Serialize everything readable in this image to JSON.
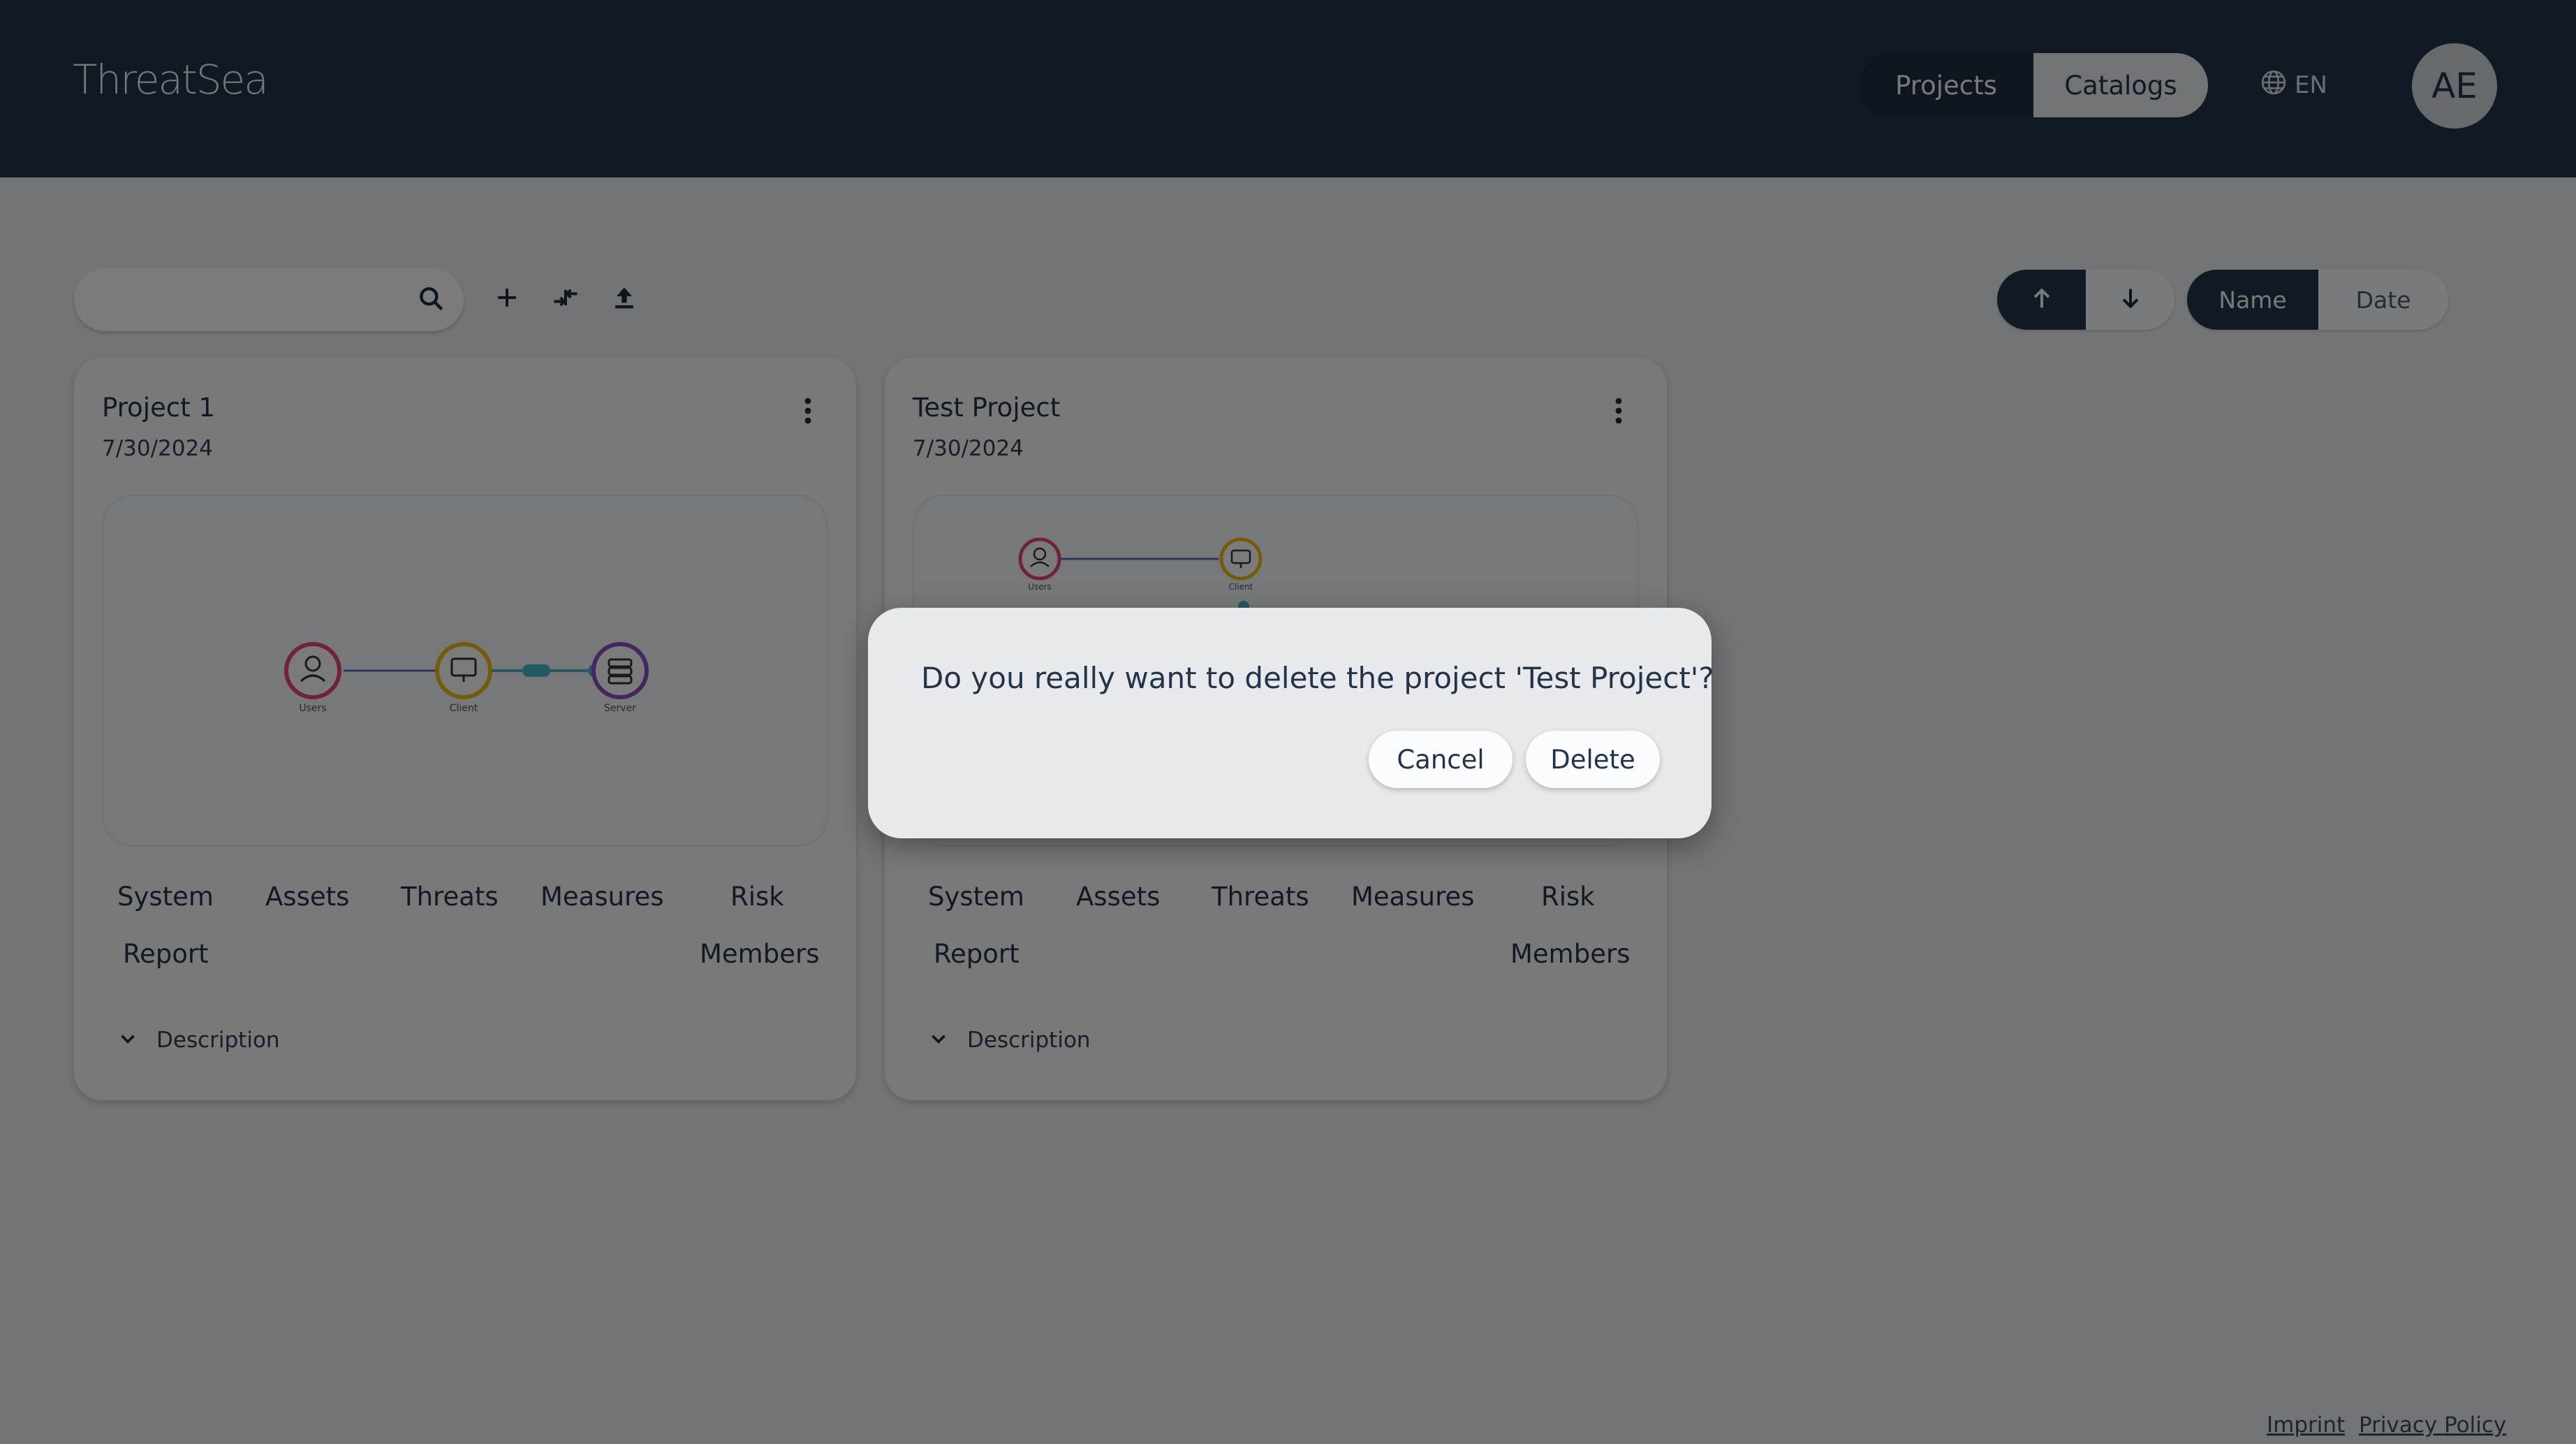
{
  "app": {
    "logo_text": "ThreatSea"
  },
  "header": {
    "nav": {
      "projects_label": "Projects",
      "catalogs_label": "Catalogs"
    },
    "language": {
      "label": "EN",
      "icon": "globe-icon"
    },
    "avatar": {
      "initials": "AE"
    }
  },
  "toolbar": {
    "search": {
      "placeholder": "",
      "icon": "search-icon"
    },
    "add_icon": "plus-icon",
    "import_icon": "import-arrows-icon",
    "upload_icon": "upload-icon",
    "sort_direction": {
      "asc_icon": "arrow-up-icon",
      "desc_icon": "arrow-down-icon",
      "selected": "asc"
    },
    "order_by": {
      "name_label": "Name",
      "date_label": "Date",
      "selected": "Name"
    }
  },
  "projects": [
    {
      "title": "Project 1",
      "date": "7/30/2024",
      "diagram": {
        "nodes": [
          "Users",
          "Client",
          "Server"
        ]
      },
      "links": {
        "system": "System",
        "assets": "Assets",
        "threats": "Threats",
        "measures": "Measures",
        "risk": "Risk",
        "report": "Report",
        "members": "Members"
      },
      "description_label": "Description"
    },
    {
      "title": "Test Project",
      "date": "7/30/2024",
      "diagram": {
        "nodes": [
          "Users",
          "Client"
        ]
      },
      "links": {
        "system": "System",
        "assets": "Assets",
        "threats": "Threats",
        "measures": "Measures",
        "risk": "Risk",
        "report": "Report",
        "members": "Members"
      },
      "description_label": "Description"
    }
  ],
  "footer": {
    "imprint": "Imprint",
    "privacy": "Privacy Policy"
  },
  "dialog": {
    "message": "Do you really want to delete the project 'Test Project'?",
    "cancel_label": "Cancel",
    "delete_label": "Delete"
  },
  "colors": {
    "header_bg": "#233348",
    "page_bg": "#e7e9ec",
    "users_node": "#e0457b",
    "client_node": "#e9b618",
    "server_node": "#8a4fbf",
    "link_teal": "#49b3c6"
  }
}
